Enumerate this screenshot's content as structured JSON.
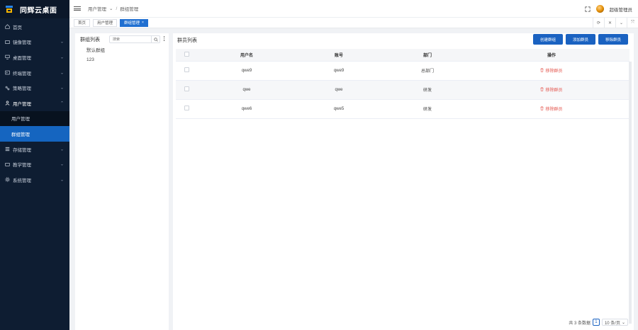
{
  "app": {
    "title": "同辉云桌面"
  },
  "sidebar": {
    "items": [
      {
        "label": "首页",
        "icon": "home-icon"
      },
      {
        "label": "镜像管理",
        "icon": "disk-icon"
      },
      {
        "label": "桌面管理",
        "icon": "monitor-icon"
      },
      {
        "label": "终端管理",
        "icon": "terminal-icon"
      },
      {
        "label": "策略管理",
        "icon": "policy-icon"
      },
      {
        "label": "用户管理",
        "icon": "user-icon",
        "sub": [
          "用户管理",
          "群组管理"
        ]
      },
      {
        "label": "存储管理",
        "icon": "storage-icon"
      },
      {
        "label": "教学管理",
        "icon": "teach-icon"
      },
      {
        "label": "系统管理",
        "icon": "settings-icon"
      }
    ]
  },
  "header": {
    "breadcrumb": [
      "用户管理",
      "群组管理"
    ],
    "user": "超级管理员"
  },
  "tabs": [
    "首页",
    "用户管理",
    "群组管理"
  ],
  "left_panel": {
    "title": "群组列表",
    "search_placeholder": "搜索",
    "groups": [
      "默认群组",
      "123"
    ]
  },
  "main_panel": {
    "title": "群员列表",
    "buttons": {
      "create": "创建群组",
      "add": "添加群员",
      "remove": "移除群员"
    },
    "columns": [
      "用户名",
      "账号",
      "部门",
      "操作"
    ],
    "rows": [
      {
        "username": "qwe9",
        "account": "qwe9",
        "dept": "总部门",
        "action": "移除群员"
      },
      {
        "username": "qwe",
        "account": "qwe",
        "dept": "研发",
        "action": "移除群员"
      },
      {
        "username": "qwe6",
        "account": "qwe5",
        "dept": "研发",
        "action": "移除群员"
      }
    ],
    "pagination": {
      "total": "共 3 条数据",
      "page": "1",
      "size": "10 条/页"
    }
  },
  "colors": {
    "sidebar_bg": "#0e1d32",
    "accent": "#1a62c1",
    "danger": "#e4574f"
  }
}
